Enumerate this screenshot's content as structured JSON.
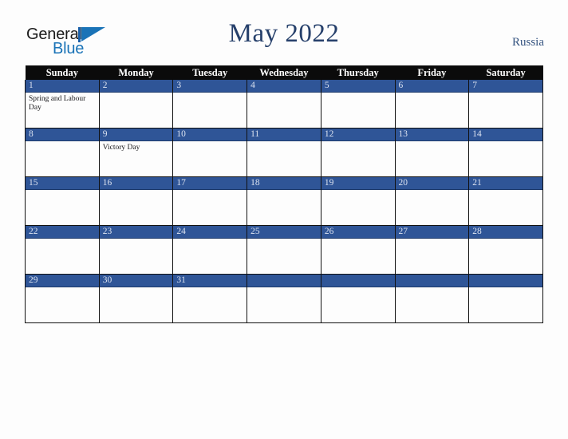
{
  "brand": {
    "word_one": "General",
    "word_two": "Blue",
    "mark_icon": "blue-flag-triangle-icon",
    "color_dark": "#1b1b1b",
    "color_blue": "#1a73b7"
  },
  "header": {
    "title": "May 2022",
    "country": "Russia",
    "title_color": "#26406b",
    "country_color": "#33527f"
  },
  "calendar": {
    "accent_color": "#2f5597",
    "header_bg": "#0b0b0b",
    "cell_bg": "#fdfdfd",
    "weekday_headers": [
      "Sunday",
      "Monday",
      "Tuesday",
      "Wednesday",
      "Thursday",
      "Friday",
      "Saturday"
    ],
    "weeks": [
      [
        {
          "date": "1",
          "events": [
            "Spring and Labour Day"
          ]
        },
        {
          "date": "2",
          "events": []
        },
        {
          "date": "3",
          "events": []
        },
        {
          "date": "4",
          "events": []
        },
        {
          "date": "5",
          "events": []
        },
        {
          "date": "6",
          "events": []
        },
        {
          "date": "7",
          "events": []
        }
      ],
      [
        {
          "date": "8",
          "events": []
        },
        {
          "date": "9",
          "events": [
            "Victory Day"
          ]
        },
        {
          "date": "10",
          "events": []
        },
        {
          "date": "11",
          "events": []
        },
        {
          "date": "12",
          "events": []
        },
        {
          "date": "13",
          "events": []
        },
        {
          "date": "14",
          "events": []
        }
      ],
      [
        {
          "date": "15",
          "events": []
        },
        {
          "date": "16",
          "events": []
        },
        {
          "date": "17",
          "events": []
        },
        {
          "date": "18",
          "events": []
        },
        {
          "date": "19",
          "events": []
        },
        {
          "date": "20",
          "events": []
        },
        {
          "date": "21",
          "events": []
        }
      ],
      [
        {
          "date": "22",
          "events": []
        },
        {
          "date": "23",
          "events": []
        },
        {
          "date": "24",
          "events": []
        },
        {
          "date": "25",
          "events": []
        },
        {
          "date": "26",
          "events": []
        },
        {
          "date": "27",
          "events": []
        },
        {
          "date": "28",
          "events": []
        }
      ],
      [
        {
          "date": "29",
          "events": []
        },
        {
          "date": "30",
          "events": []
        },
        {
          "date": "31",
          "events": []
        },
        {
          "date": "",
          "events": []
        },
        {
          "date": "",
          "events": []
        },
        {
          "date": "",
          "events": []
        },
        {
          "date": "",
          "events": []
        }
      ]
    ]
  }
}
